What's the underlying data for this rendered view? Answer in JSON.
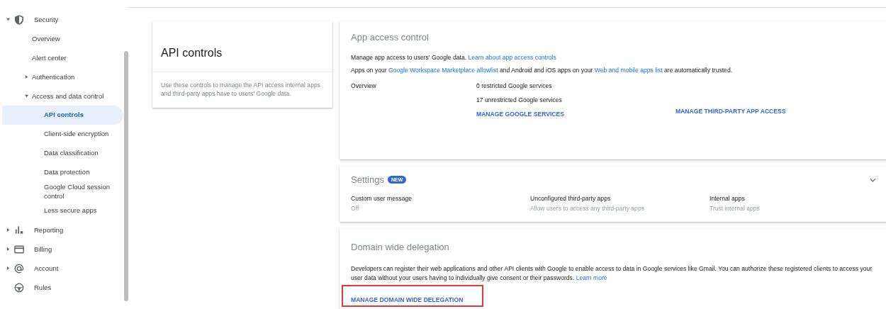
{
  "sidebar": {
    "items": [
      {
        "label": "Security",
        "expanded": true,
        "children": [
          {
            "label": "Overview",
            "selected": false
          },
          {
            "label": "Alert center",
            "selected": false
          },
          {
            "label": "Authentication",
            "expanded": false,
            "selected": false
          },
          {
            "label": "Access and data control",
            "expanded": true,
            "selected": false,
            "children": [
              {
                "label": "API controls",
                "selected": true
              },
              {
                "label": "Client-side encryption",
                "selected": false
              },
              {
                "label": "Data classification",
                "selected": false
              },
              {
                "label": "Data protection",
                "selected": false
              },
              {
                "label": "Google Cloud session control",
                "selected": false
              },
              {
                "label": "Less secure apps",
                "selected": false
              }
            ]
          }
        ]
      },
      {
        "label": "Reporting",
        "expanded": false
      },
      {
        "label": "Billing",
        "expanded": false
      },
      {
        "label": "Account",
        "expanded": false
      },
      {
        "label": "Rules"
      }
    ]
  },
  "intro_card": {
    "title": "API controls",
    "description": "Use these controls to manage the API access internal apps and third-party apps have to users' Google data."
  },
  "app_access_control": {
    "title": "App access control",
    "lines": [
      [
        {
          "kind": "text",
          "text": "Manage app access to users' Google data."
        },
        {
          "kind": "link",
          "text": "Learn about app access controls"
        }
      ],
      [
        {
          "kind": "text",
          "text": "Apps on your"
        },
        {
          "kind": "link",
          "text": "Google Workspace Marketplace allowlist"
        },
        {
          "kind": "text",
          "text": "and Android and iOS apps on your"
        },
        {
          "kind": "link",
          "text": "Web and mobile apps list"
        },
        {
          "kind": "text",
          "text": "are automatically trusted."
        }
      ]
    ],
    "overview_label": "Overview",
    "stats": [
      "0 restricted Google services",
      "17 unrestricted Google services"
    ],
    "actions": [
      "MANAGE GOOGLE SERVICES",
      "MANAGE THIRD-PARTY APP ACCESS"
    ]
  },
  "settings": {
    "title": "Settings",
    "badge": "NEW",
    "expanded": false,
    "items": [
      {
        "label": "Custom user message",
        "value": "Off"
      },
      {
        "label": "Unconfigured third-party apps",
        "value": "Allow users to access any third-party apps"
      },
      {
        "label": "Internal apps",
        "value": "Trust internal apps"
      }
    ]
  },
  "domain_wide_delegation": {
    "title": "Domain wide delegation",
    "text": [
      {
        "kind": "text",
        "text": "Developers can register their web applications and other API clients with Google to enable access to data in Google services like Gmail. You can authorize these registered clients to access your user data without your users having to individually give consent or their passwords."
      },
      {
        "kind": "link",
        "text": "Learn more"
      }
    ],
    "action": {
      "label": "MANAGE DOMAIN WIDE DELEGATION",
      "highlighted": true
    }
  }
}
